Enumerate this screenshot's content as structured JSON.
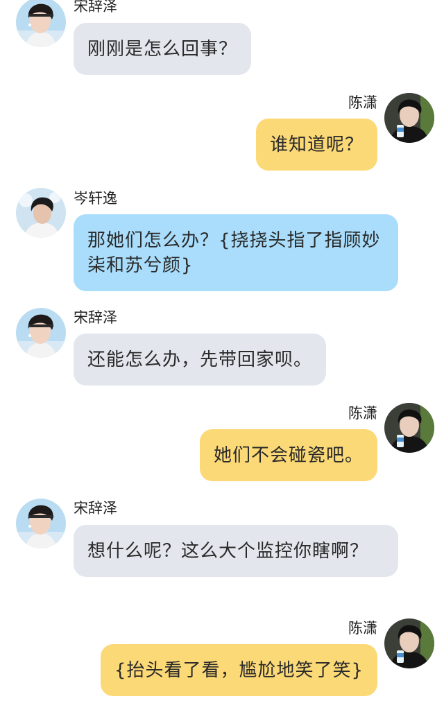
{
  "messages": [
    {
      "speaker": "宋辞泽",
      "side": "left",
      "avatar": "song-cize-avatar",
      "bubble_color": "#e3e6ed",
      "text": "刚刚是怎么回事？"
    },
    {
      "speaker": "陈潇",
      "side": "right",
      "avatar": "chen-xiao-avatar",
      "bubble_color": "#fcd977",
      "text": "谁知道呢？"
    },
    {
      "speaker": "岑轩逸",
      "side": "left",
      "avatar": "cen-xuanyi-avatar",
      "bubble_color": "#a9ddfb",
      "text": "那她们怎么办？{挠挠头指了指顾妙柒和苏兮颜}"
    },
    {
      "speaker": "宋辞泽",
      "side": "left",
      "avatar": "song-cize-avatar",
      "bubble_color": "#e3e6ed",
      "text": "还能怎么办，先带回家呗。"
    },
    {
      "speaker": "陈潇",
      "side": "right",
      "avatar": "chen-xiao-avatar",
      "bubble_color": "#fcd977",
      "text": "她们不会碰瓷吧。"
    },
    {
      "speaker": "宋辞泽",
      "side": "left",
      "avatar": "song-cize-avatar",
      "bubble_color": "#e3e6ed",
      "text": "想什么呢？这么大个监控你瞎啊？"
    },
    {
      "speaker": "陈潇",
      "side": "right",
      "avatar": "chen-xiao-avatar",
      "bubble_color": "#fcd977",
      "text": "{抬头看了看，尴尬地笑了笑}"
    }
  ]
}
